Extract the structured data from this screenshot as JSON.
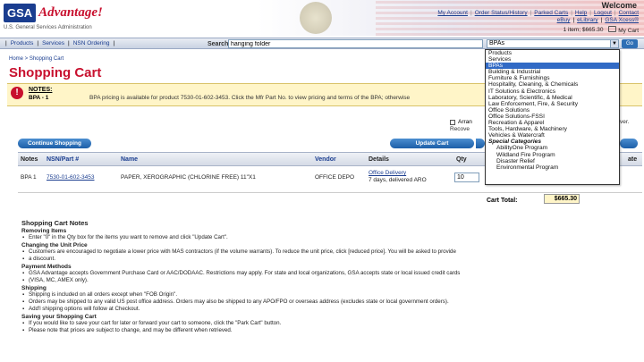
{
  "header": {
    "logo_box": "GSA",
    "logo_text": "Advantage!",
    "gov_line": "U.S. General Services Administration",
    "welcome": "Welcome",
    "top_links": [
      "My Account",
      "Order Status/History",
      "Parked Carts",
      "Help",
      "Logout",
      "Contact"
    ],
    "sub_links": [
      "eBuy",
      "eLibrary",
      "GSA Xcess®"
    ],
    "cart_items": "1 item; $665.30",
    "my_cart": "My Cart"
  },
  "nav": {
    "tabs": [
      "Products",
      "Services",
      "NSN Ordering"
    ],
    "search_label": "Search",
    "search_value": "hanging folder",
    "select_value": "BPAs",
    "go_label": "Go"
  },
  "breadcrumb": "Home > Shopping Cart",
  "page_title": "Shopping Cart",
  "notes": {
    "label": "NOTES:",
    "bpa": "BPA - 1",
    "message": "BPA pricing is available for product 7530-01-602-3453. Click the Mfr Part No. to view pricing and terms of the BPA; otherwise"
  },
  "side": {
    "opt1": "Arran",
    "opt2": "Recove",
    "right_text": "ver."
  },
  "buttons": {
    "continue": "Continue Shopping",
    "update": "Update Cart"
  },
  "table": {
    "headers": [
      "Notes",
      "NSN/Part #",
      "Name",
      "Vendor",
      "Details",
      "Qty",
      "ate"
    ],
    "row": {
      "note": "BPA 1",
      "part": "7530-01-602-3453",
      "name": "PAPER, XEROGRAPHIC (CHLORINE FREE) 11\"X1",
      "vendor": "OFFICE DEPO",
      "details_link": "Office Delivery",
      "details_text": "7 days, delivered ARO",
      "qty": "10"
    },
    "total_label": "Cart Total:",
    "total_value": "$665.30"
  },
  "cart_notes": {
    "title": "Shopping Cart Notes",
    "sections": [
      {
        "heading": "Removing Items",
        "items": [
          "Enter \"0\" in the Qty box for the items you want to remove and click \"Update Cart\"."
        ]
      },
      {
        "heading": "Changing the Unit Price",
        "items": [
          "Customers are encouraged to negotiate a lower price with MAS contractors (if the volume warrants). To reduce the unit price, click [reduced price]. You will be asked to provide",
          "a discount."
        ]
      },
      {
        "heading": "Payment Methods",
        "items": [
          "GSA Advantage accepts Government Purchase Card or AAC/DODAAC. Restrictions may apply. For state and local organizations, GSA accepts state or local issued credit cards",
          "(VISA, MC, AMEX only)."
        ]
      },
      {
        "heading": "Shipping",
        "items": [
          "Shipping is included on all orders except when \"FOB Origin\".",
          "Orders may be shipped to any valid US post office address. Orders may also be shipped to any APO/FPO or overseas address (excludes state or local government orders).",
          "Add'l shipping options will follow at Checkout."
        ]
      },
      {
        "heading": "Saving your Shopping Cart",
        "items": [
          "If you would like to save your cart for later or forward your cart to someone, click the \"Park Cart\" button.",
          "Please note that prices are subject to change, and may be different when retrieved."
        ]
      }
    ]
  },
  "dropdown": {
    "items": [
      {
        "label": "Products",
        "type": "normal"
      },
      {
        "label": "Services",
        "type": "normal"
      },
      {
        "label": "BPAs",
        "type": "selected"
      },
      {
        "label": "Building & Industrial",
        "type": "normal"
      },
      {
        "label": "Furniture & Furnishings",
        "type": "normal"
      },
      {
        "label": "Hospitality, Cleaning, & Chemicals",
        "type": "normal"
      },
      {
        "label": "IT Solutions & Electronics",
        "type": "normal"
      },
      {
        "label": "Laboratory, Scientific, & Medical",
        "type": "normal"
      },
      {
        "label": "Law Enforcement, Fire, & Security",
        "type": "normal"
      },
      {
        "label": "Office Solutions",
        "type": "normal"
      },
      {
        "label": "Office Solutions-FSSI",
        "type": "normal"
      },
      {
        "label": "Recreation & Apparel",
        "type": "normal"
      },
      {
        "label": "Tools, Hardware, & Machinery",
        "type": "normal"
      },
      {
        "label": "Vehicles & Watercraft",
        "type": "normal"
      },
      {
        "label": "Special Categories",
        "type": "header"
      },
      {
        "label": "AbilityOne Program",
        "type": "sub"
      },
      {
        "label": "Wildland Fire Program",
        "type": "sub"
      },
      {
        "label": "Disaster Relief",
        "type": "sub"
      },
      {
        "label": "Environmental Program",
        "type": "sub"
      }
    ]
  }
}
